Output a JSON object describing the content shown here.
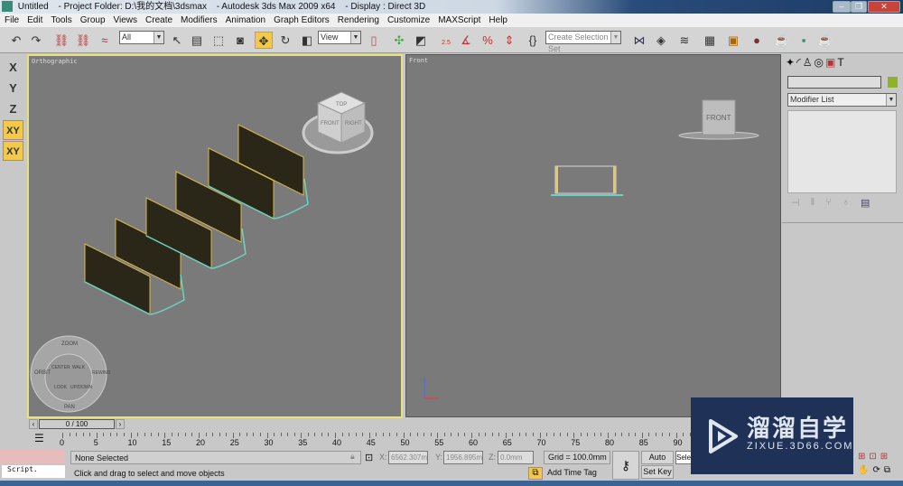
{
  "title": {
    "file": "Untitled",
    "project": "- Project Folder: D:\\我的文档\\3dsmax",
    "app": "- Autodesk 3ds Max  2009 x64",
    "display": "- Display : Direct 3D"
  },
  "menu": [
    "File",
    "Edit",
    "Tools",
    "Group",
    "Views",
    "Create",
    "Modifiers",
    "Animation",
    "Graph Editors",
    "Rendering",
    "Customize",
    "MAXScript",
    "Help"
  ],
  "toolbar": {
    "selection_filter": "All",
    "ref_coord": "View",
    "named_selection": "Create Selection Set",
    "snap_label": "2.5"
  },
  "axis_constraints": [
    "X",
    "Y",
    "Z",
    "XY",
    "XY"
  ],
  "viewports": {
    "ortho": {
      "label": "Orthographic",
      "viewcube": [
        "TOP",
        "FRONT",
        "RIGHT"
      ],
      "wheel": [
        "ZOOM",
        "ORBIT",
        "CENTER",
        "WALK",
        "REWIND",
        "LOOK",
        "UP/DOWN",
        "PAN"
      ]
    },
    "front": {
      "label": "Front",
      "viewcube": "FRONT"
    }
  },
  "command_panel": {
    "modifier_list": "Modifier List",
    "color": "#8db32a"
  },
  "timeslider": {
    "value": "0 / 100",
    "current": 0,
    "max": 100
  },
  "trackbar": {
    "ticks": [
      0,
      5,
      10,
      15,
      20,
      25,
      30,
      35,
      40,
      45,
      50,
      55,
      60,
      65,
      70,
      75,
      80,
      85,
      90
    ]
  },
  "status": {
    "selection": "None Selected",
    "prompt": "Click and drag to select and move objects",
    "x": "6562.307m",
    "y": "1956.895m",
    "z": "0.0mm",
    "grid": "Grid = 100.0mm",
    "add_time_tag": "Add Time Tag",
    "auto_key": "Auto Key",
    "set_key": "Set Key",
    "sel": "Sele",
    "script": "Script."
  },
  "watermark": {
    "cn": "溜溜自学",
    "url": "ZIXUE.3D66.COM"
  }
}
